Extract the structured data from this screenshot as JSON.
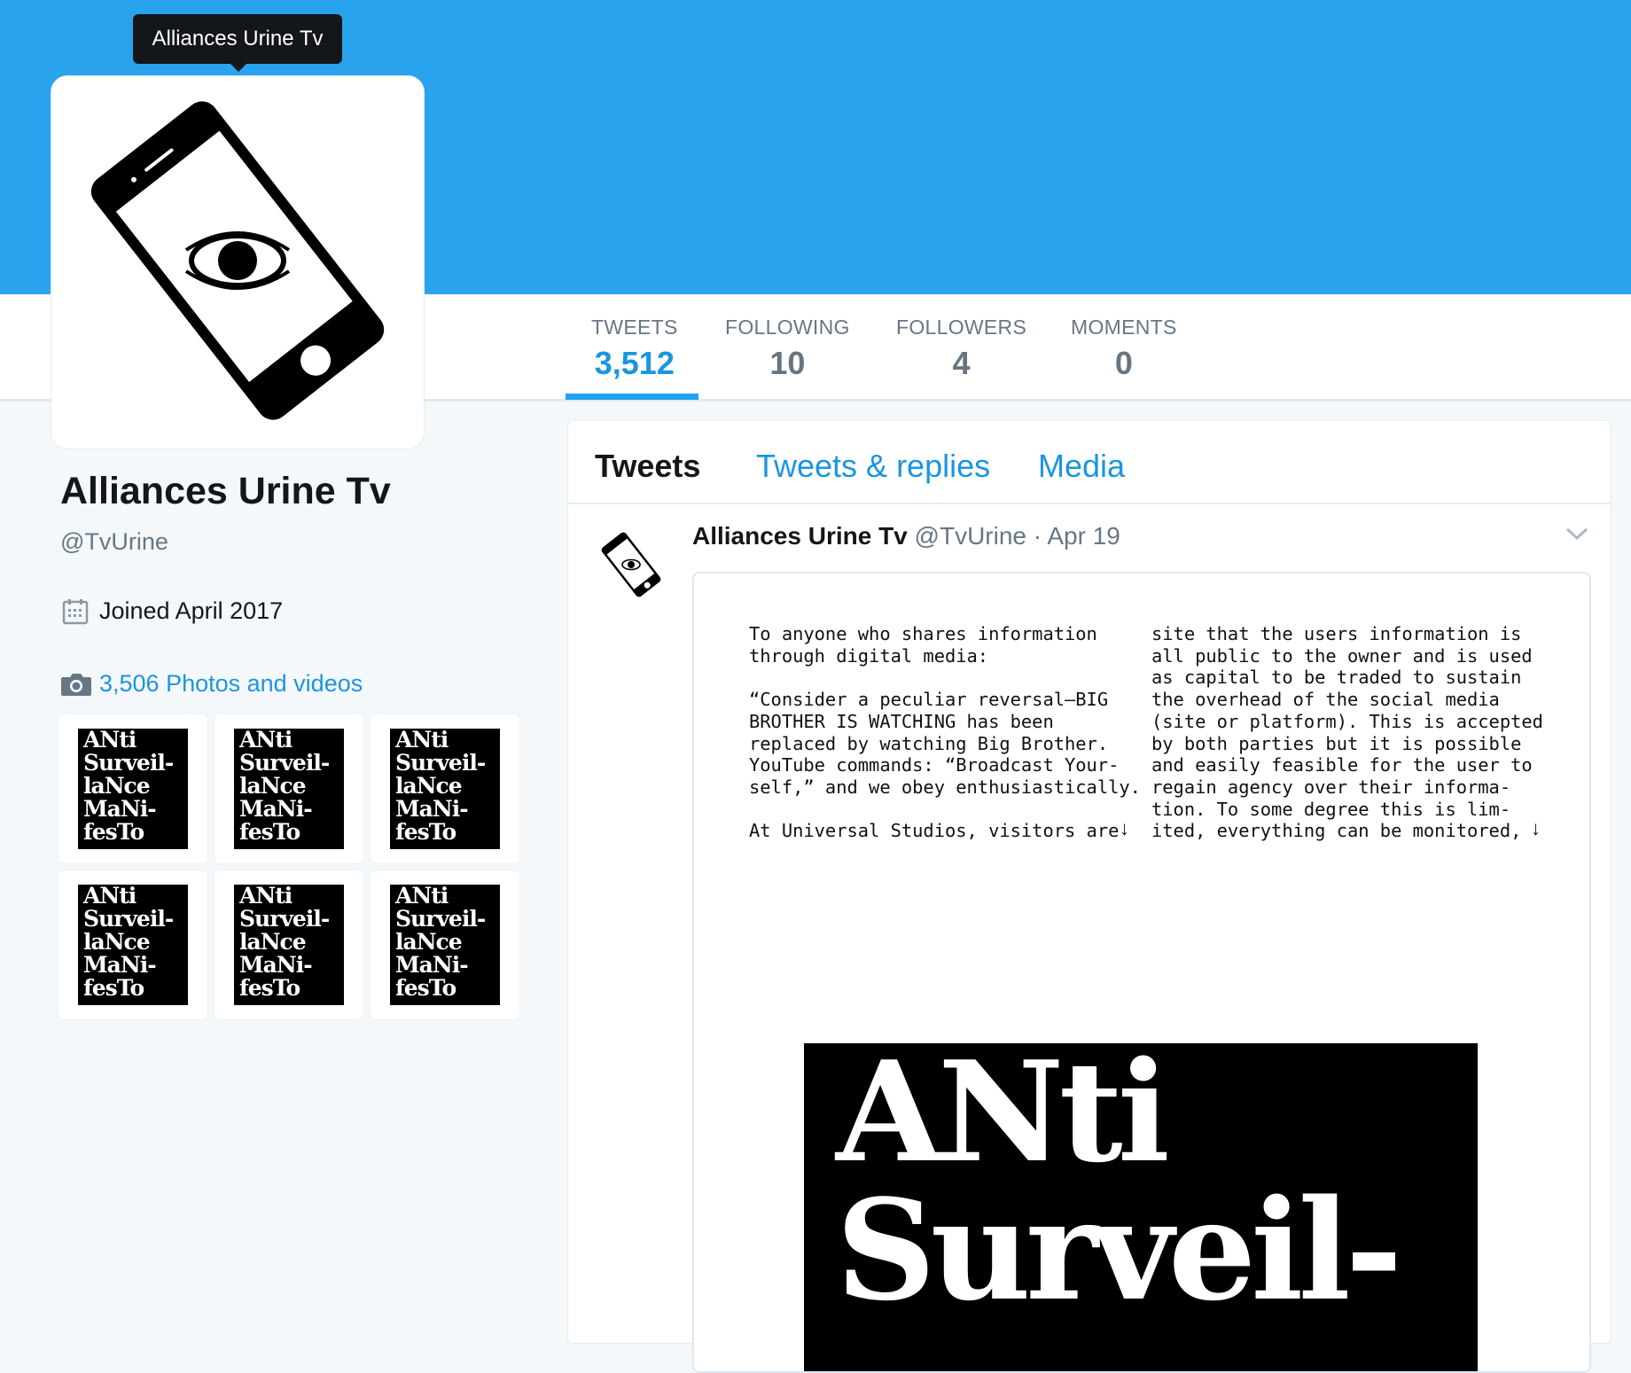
{
  "tooltip": {
    "text": "Alliances Urine Tv"
  },
  "stats": [
    {
      "label": "TWEETS",
      "value": "3,512",
      "active": true
    },
    {
      "label": "FOLLOWING",
      "value": "10"
    },
    {
      "label": "FOLLOWERS",
      "value": "4"
    },
    {
      "label": "MOMENTS",
      "value": "0"
    }
  ],
  "profile": {
    "name": "Alliances Urine Tv",
    "handle": "@TvUrine",
    "joined": "Joined April 2017",
    "photos_link": "3,506 Photos and videos",
    "avatar_icon": "phone-eye-icon"
  },
  "thumbnails": {
    "count": 6,
    "lines": [
      "ANti",
      "Surveil-",
      "laNce",
      "MaNi-",
      "fesTo"
    ]
  },
  "tabs": [
    {
      "label": "Tweets",
      "active": true
    },
    {
      "label": "Tweets & replies"
    },
    {
      "label": "Media"
    }
  ],
  "tweet": {
    "name": "Alliances Urine Tv",
    "handle": "@TvUrine",
    "separator": "·",
    "date": "Apr 19",
    "media": {
      "col1": "To anyone who shares information\nthrough digital media:\n\n“Consider a peculiar reversal—BIG\nBROTHER IS WATCHING has been\nreplaced by watching Big Brother.\nYouTube commands: “Broadcast Your-\nself,” and we obey enthusiastically.\n\nAt Universal Studios, visitors are",
      "col2": "site that the users information is\nall public to the owner and is used\nas capital to be traded to sustain\nthe overhead of the social media\n(site or platform). This is accepted\nby both parties but it is possible\nand easily feasible for the user to\nregain agency over their informa-\ntion. To some degree this is lim-\nited, everything can be monitored,",
      "arrow": "↓",
      "title_lines": [
        "ANti",
        "Surveil-"
      ]
    }
  },
  "colors": {
    "banner": "#2aa3ef",
    "accent": "#1b95e0",
    "muted": "#657786"
  }
}
